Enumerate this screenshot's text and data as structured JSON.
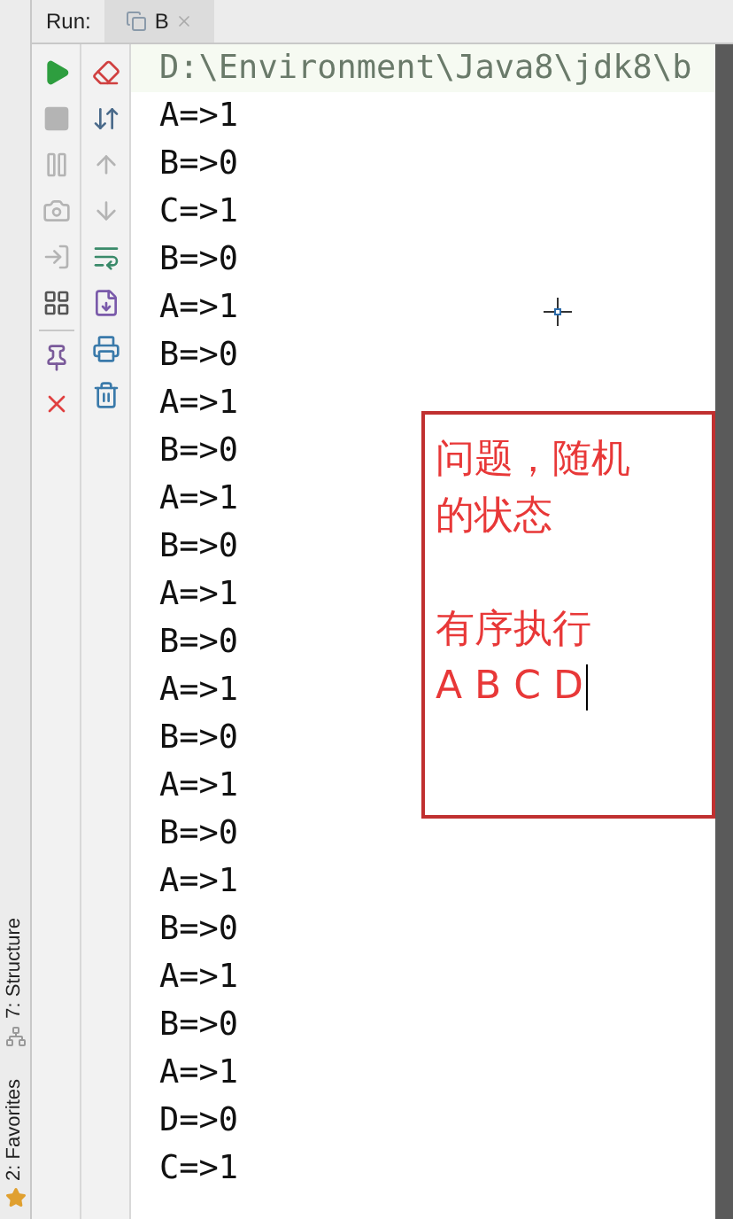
{
  "run_bar": {
    "label": "Run:",
    "tab": {
      "title": "B",
      "selected": true
    }
  },
  "toolbar_left": [
    {
      "kind": "run",
      "disabled": false
    },
    {
      "kind": "stop",
      "disabled": true
    },
    {
      "kind": "pause",
      "disabled": true
    },
    {
      "kind": "camera",
      "disabled": true
    },
    {
      "kind": "exit",
      "disabled": true
    },
    {
      "kind": "layout",
      "disabled": false
    },
    {
      "kind": "divider"
    },
    {
      "kind": "pin",
      "disabled": false
    },
    {
      "kind": "close",
      "disabled": false
    }
  ],
  "toolbar_right": [
    {
      "kind": "clear",
      "disabled": false
    },
    {
      "kind": "sort",
      "disabled": false
    },
    {
      "kind": "up",
      "disabled": true
    },
    {
      "kind": "down",
      "disabled": true
    },
    {
      "kind": "wrap",
      "disabled": false
    },
    {
      "kind": "import",
      "disabled": false
    },
    {
      "kind": "print",
      "disabled": false
    },
    {
      "kind": "trash",
      "disabled": false
    }
  ],
  "side_tabs": [
    {
      "label": "7: Structure",
      "kind": "structure"
    },
    {
      "label": "2: Favorites",
      "kind": "favorites"
    }
  ],
  "console": {
    "command": "D:\\Environment\\Java8\\jdk8\\b",
    "lines": [
      "A=>1",
      "B=>0",
      "C=>1",
      "B=>0",
      "A=>1",
      "B=>0",
      "A=>1",
      "B=>0",
      "A=>1",
      "B=>0",
      "A=>1",
      "B=>0",
      "A=>1",
      "B=>0",
      "A=>1",
      "B=>0",
      "A=>1",
      "B=>0",
      "A=>1",
      "B=>0",
      "A=>1",
      "D=>0",
      "C=>1"
    ]
  },
  "annotation": {
    "paragraphs": [
      {
        "lines": [
          "问题，随机",
          "的状态"
        ]
      },
      {
        "lines": [
          "有序执行",
          "A B C D"
        ]
      }
    ]
  }
}
